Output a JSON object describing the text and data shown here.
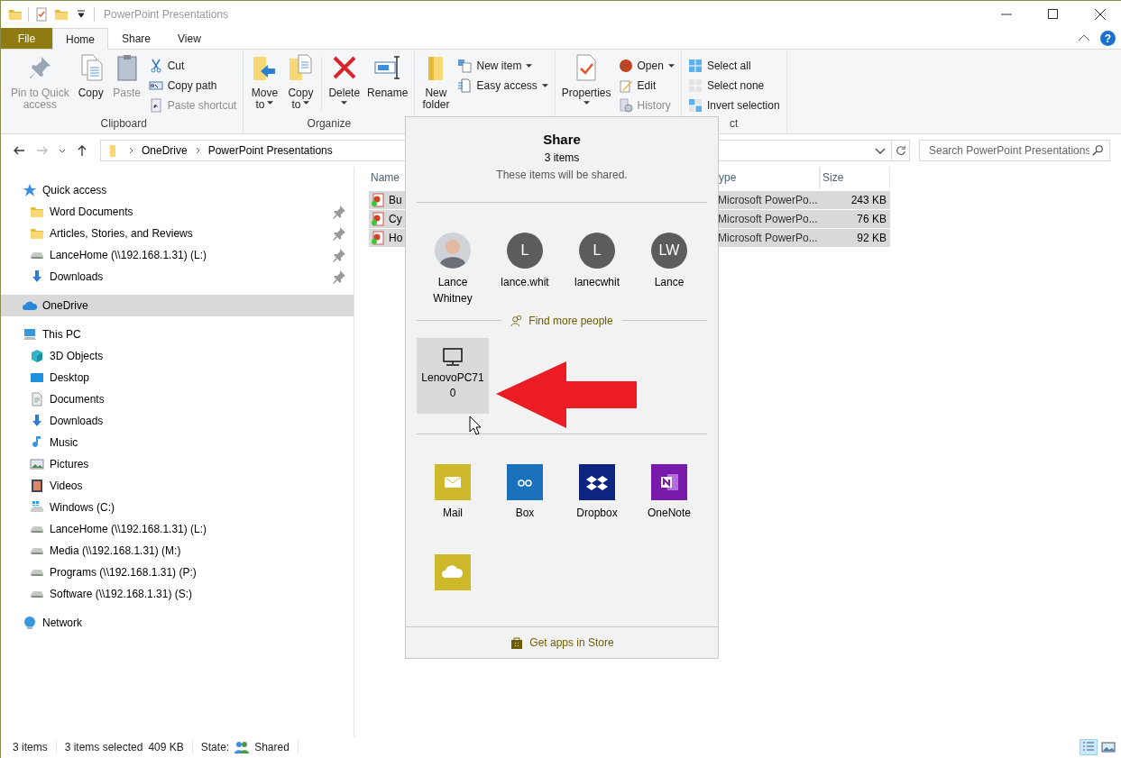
{
  "window": {
    "title": "PowerPoint Presentations"
  },
  "ribbon": {
    "tabs": [
      {
        "label": "File",
        "kind": "file",
        "selected": false
      },
      {
        "label": "Home",
        "kind": "tab",
        "selected": true
      },
      {
        "label": "Share",
        "kind": "tab",
        "selected": false
      },
      {
        "label": "View",
        "kind": "tab",
        "selected": false
      }
    ],
    "help_button": "?",
    "groups": [
      {
        "label": "Clipboard",
        "columns": [
          {
            "kind": "large",
            "label": "Pin to Quick\naccess",
            "disabled": true
          },
          {
            "kind": "large",
            "label": "Copy",
            "disabled": false
          },
          {
            "kind": "large",
            "label": "Paste",
            "disabled": true
          },
          {
            "kind": "stack",
            "items": [
              {
                "label": "Cut",
                "disabled": false
              },
              {
                "label": "Copy path",
                "disabled": false
              },
              {
                "label": "Paste shortcut",
                "disabled": true
              }
            ]
          }
        ]
      },
      {
        "label": "Organize",
        "columns": [
          {
            "kind": "large",
            "label": "Move\nto",
            "disabled": false,
            "dropdown": true
          },
          {
            "kind": "large",
            "label": "Copy\nto",
            "disabled": false,
            "dropdown": true
          },
          {
            "kind": "separator"
          },
          {
            "kind": "split",
            "label": "Delete",
            "disabled": false,
            "dropdown": true
          },
          {
            "kind": "large",
            "label": "Rename",
            "disabled": false
          }
        ]
      },
      {
        "columns": [
          {
            "kind": "large",
            "label": "New\nfolder",
            "disabled": false
          },
          {
            "kind": "stack",
            "items": [
              {
                "label": "New item",
                "disabled": false,
                "dropdown": true
              },
              {
                "label": "Easy access",
                "disabled": false,
                "dropdown": true
              }
            ]
          }
        ]
      },
      {
        "columns": [
          {
            "kind": "split",
            "label": "Properties",
            "disabled": false,
            "dropdown": true
          },
          {
            "kind": "stack",
            "items": [
              {
                "label": "Open",
                "disabled": false,
                "dropdown": true
              },
              {
                "label": "Edit",
                "disabled": false
              },
              {
                "label": "History",
                "disabled": true
              }
            ]
          }
        ]
      },
      {
        "label": "ct",
        "columns": [
          {
            "kind": "stack",
            "items": [
              {
                "label": "Select all",
                "disabled": false
              },
              {
                "label": "Select none",
                "disabled": false
              },
              {
                "label": "Invert selection",
                "disabled": false
              }
            ]
          }
        ]
      }
    ]
  },
  "address": {
    "crumbs": [
      "OneDrive",
      "PowerPoint Presentations"
    ],
    "search": {
      "placeholder": "Search PowerPoint Presentations"
    }
  },
  "nav": {
    "items": [
      {
        "label": "Quick access",
        "kind": "star",
        "selected": false,
        "children": [
          {
            "label": "Word Documents",
            "kind": "folder",
            "selected": false,
            "pinned": true
          },
          {
            "label": "Articles, Stories, and Reviews",
            "kind": "folder",
            "selected": false,
            "pinned": true
          },
          {
            "label": "LanceHome (\\\\192.168.1.31) (L:)",
            "kind": "drive",
            "selected": false,
            "pinned": true
          },
          {
            "label": "Downloads",
            "kind": "download",
            "selected": false,
            "pinned": true
          }
        ]
      },
      {
        "label": "OneDrive",
        "kind": "cloud",
        "selected": true
      },
      {
        "label": "This PC",
        "kind": "pc",
        "selected": false,
        "children": [
          {
            "label": "3D Objects",
            "kind": "cube",
            "selected": false
          },
          {
            "label": "Desktop",
            "kind": "desktop",
            "selected": false
          },
          {
            "label": "Documents",
            "kind": "documents",
            "selected": false
          },
          {
            "label": "Downloads",
            "kind": "download",
            "selected": false
          },
          {
            "label": "Music",
            "kind": "music",
            "selected": false
          },
          {
            "label": "Pictures",
            "kind": "pictures",
            "selected": false
          },
          {
            "label": "Videos",
            "kind": "videos",
            "selected": false
          },
          {
            "label": "Windows (C:)",
            "kind": "windows",
            "selected": false
          },
          {
            "label": "LanceHome (\\\\192.168.1.31) (L:)",
            "kind": "drive",
            "selected": false
          },
          {
            "label": "Media (\\\\192.168.1.31) (M:)",
            "kind": "drive",
            "selected": false
          },
          {
            "label": "Programs (\\\\192.168.1.31) (P:)",
            "kind": "drive",
            "selected": false
          },
          {
            "label": "Software (\\\\192.168.1.31) (S:)",
            "kind": "drive",
            "selected": false
          }
        ]
      },
      {
        "label": "Network",
        "kind": "network",
        "selected": false
      }
    ]
  },
  "table": {
    "columns": [
      {
        "label": "Name"
      },
      {
        "label": "ype"
      },
      {
        "label": "Size"
      }
    ],
    "rows": [
      {
        "name": "Bu",
        "type": "Microsoft PowerPo...",
        "size": "243 KB",
        "selected": true
      },
      {
        "name": "Cy",
        "type": "Microsoft PowerPo...",
        "size": "76 KB",
        "selected": true
      },
      {
        "name": "Ho",
        "type": "Microsoft PowerPo...",
        "size": "92 KB",
        "selected": true
      }
    ]
  },
  "share": {
    "title": "Share",
    "count": "3 items",
    "subtitle": "These items will be shared.",
    "people": [
      {
        "kind": "photo",
        "name": "Lance Whitney"
      },
      {
        "kind": "initials",
        "initials": "L",
        "name": "lance.whit"
      },
      {
        "kind": "initials",
        "initials": "L",
        "name": "lanecwhit"
      },
      {
        "kind": "initials",
        "initials": "LW",
        "name": "Lance"
      }
    ],
    "find_more": "Find more people",
    "devices": [
      {
        "name": "LenovoPC710",
        "selected": true
      }
    ],
    "apps": [
      {
        "label": "Mail",
        "color": "#cdb82a"
      },
      {
        "label": "Box",
        "color": "#1b72bc"
      },
      {
        "label": "Dropbox",
        "color": "#0d2481"
      },
      {
        "label": "OneNote",
        "color": "#7719aa"
      },
      {
        "color": "#cdb82a"
      }
    ],
    "store_link": "Get apps in Store"
  },
  "status_bar": {
    "items": "3 items",
    "selection": "3 items selected",
    "size": "409 KB",
    "state_label": "State:",
    "state": "Shared",
    "view_buttons": [
      {
        "selected": true
      },
      {
        "selected": false
      }
    ]
  }
}
